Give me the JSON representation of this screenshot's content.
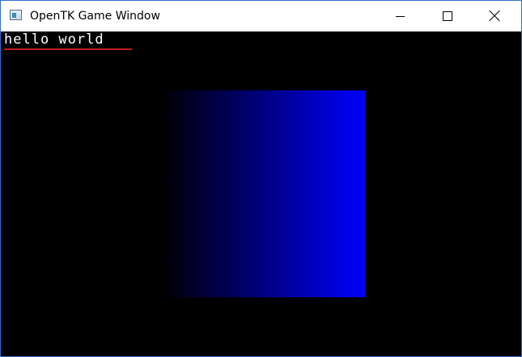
{
  "window": {
    "title": "OpenTK Game Window",
    "app_icon": "window-app-icon",
    "caption_buttons": {
      "minimize_icon": "minimize-icon",
      "maximize_icon": "maximize-icon",
      "close_icon": "close-icon"
    },
    "border_color": "#2f6fd4"
  },
  "viewport": {
    "background_color": "#000000",
    "overlay_text": "hello world",
    "overlay_text_color": "#ffffff",
    "underline_color": "#c41e1e",
    "quad": {
      "gradient_start_color": "#000000",
      "gradient_end_color": "#0000ff"
    }
  }
}
